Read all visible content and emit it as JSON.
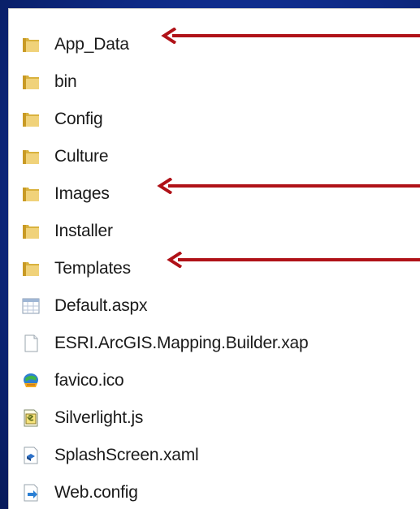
{
  "explorer": {
    "items": [
      {
        "label": "App_Data",
        "type": "folder",
        "icon": "folder-icon"
      },
      {
        "label": "bin",
        "type": "folder",
        "icon": "folder-icon"
      },
      {
        "label": "Config",
        "type": "folder",
        "icon": "folder-icon"
      },
      {
        "label": "Culture",
        "type": "folder",
        "icon": "folder-icon"
      },
      {
        "label": "Images",
        "type": "folder",
        "icon": "folder-icon"
      },
      {
        "label": "Installer",
        "type": "folder",
        "icon": "folder-icon"
      },
      {
        "label": "Templates",
        "type": "folder",
        "icon": "folder-icon"
      },
      {
        "label": "Default.aspx",
        "type": "file",
        "icon": "aspx-file-icon"
      },
      {
        "label": "ESRI.ArcGIS.Mapping.Builder.xap",
        "type": "file",
        "icon": "blank-file-icon"
      },
      {
        "label": "favico.ico",
        "type": "file",
        "icon": "ico-file-icon"
      },
      {
        "label": "Silverlight.js",
        "type": "file",
        "icon": "js-file-icon"
      },
      {
        "label": "SplashScreen.xaml",
        "type": "file",
        "icon": "xaml-file-icon"
      },
      {
        "label": "Web.config",
        "type": "file",
        "icon": "config-file-icon"
      }
    ]
  },
  "colors": {
    "arrow": "#b01218",
    "background": "#0e2a85",
    "folder": "#e8c65a"
  }
}
